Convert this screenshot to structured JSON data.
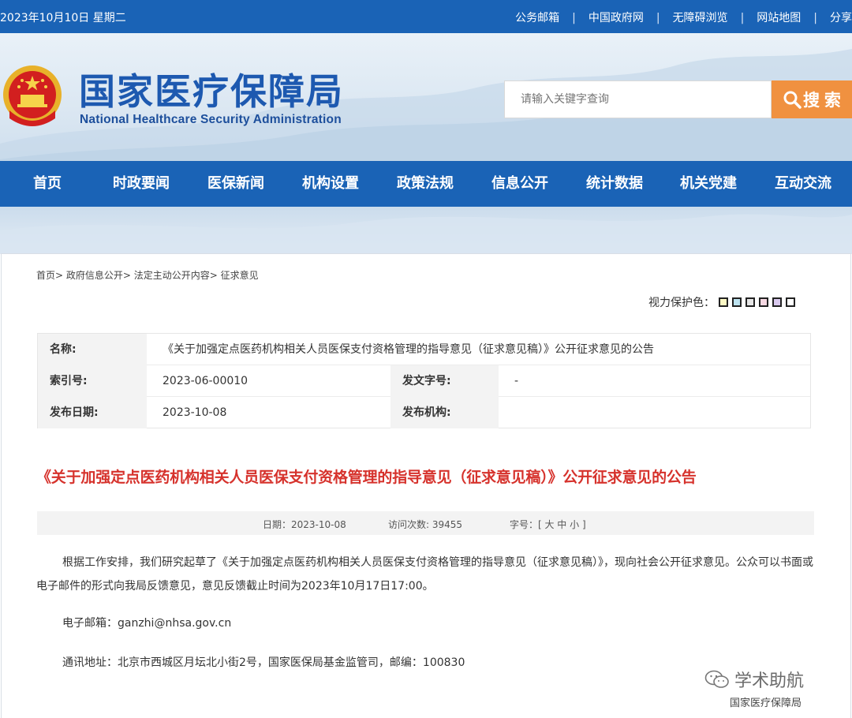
{
  "topbar": {
    "date": "2023年10月10日 星期二",
    "links": [
      "公务邮箱",
      "中国政府网",
      "无障碍浏览",
      "网站地图",
      "分享"
    ]
  },
  "header": {
    "logo_cn": "国家医疗保障局",
    "logo_en": "National Healthcare Security Administration",
    "search_placeholder": "请输入关键字查询",
    "search_button": "搜 索"
  },
  "nav": [
    "首页",
    "时政要闻",
    "医保新闻",
    "机构设置",
    "政策法规",
    "信息公开",
    "统计数据",
    "机关党建",
    "互动交流"
  ],
  "breadcrumb": "首页> 政府信息公开> 法定主动公开内容> 征求意见",
  "eye_protect": {
    "label": "视力保护色：",
    "colors": [
      "#fdf9c5",
      "#bde3f0",
      "#e6e6e6",
      "#f7d9e3",
      "#d9c9ee",
      "#ffffff"
    ]
  },
  "meta": {
    "name_label": "名称:",
    "name_value": "《关于加强定点医药机构相关人员医保支付资格管理的指导意见（征求意见稿）》公开征求意见的公告",
    "index_label": "索引号:",
    "index_value": "2023-06-00010",
    "docno_label": "发文字号:",
    "docno_value": "-",
    "date_label": "发布日期:",
    "date_value": "2023-10-08",
    "org_label": "发布机构:",
    "org_value": ""
  },
  "article": {
    "title": "《关于加强定点医药机构相关人员医保支付资格管理的指导意见（征求意见稿）》公开征求意见的公告",
    "info_date": "日期：2023-10-08",
    "info_visits": "访问次数:   39455",
    "info_font": "字号：[ 大 中 小 ]",
    "para1": "根据工作安排，我们研究起草了《关于加强定点医药机构相关人员医保支付资格管理的指导意见（征求意见稿）》，现向社会公开征求意见。公众可以书面或电子邮件的形式向我局反馈意见，意见反馈截止时间为2023年10月17日17:00。",
    "email": "电子邮箱：ganzhi@nhsa.gov.cn",
    "address": "通讯地址：北京市西城区月坛北小街2号，国家医保局基金监管司，邮编：100830"
  },
  "watermark": {
    "title": "学术助航",
    "subtitle": "国家医疗保障局"
  }
}
